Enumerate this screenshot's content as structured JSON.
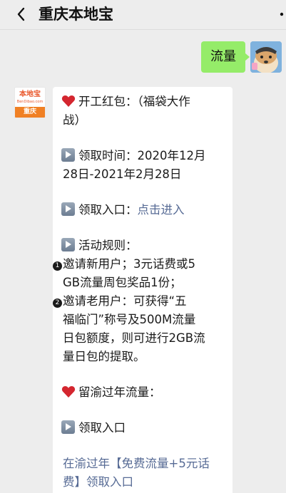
{
  "header": {
    "back_icon": "chevron-left-icon",
    "title": "重庆本地宝",
    "more_icon": "more-dots-icon"
  },
  "outgoing": {
    "text": "流量",
    "bubble_color": "#95ec69"
  },
  "brand_avatar": {
    "top_text": "本地宝",
    "site_text": "BenDibao.com",
    "city_text": "重庆",
    "accent": "#f08024"
  },
  "message": {
    "l1a": "开工红包：（福袋大作",
    "l1b": "战）",
    "time_label_a": "领取时间：2020年12月",
    "time_label_b": "28日-2021年2月28日",
    "entry_label": "领取入口：",
    "entry_link": "点击进入",
    "rules_title": "活动规则：",
    "rule1_num": "1",
    "rule1_a": "邀请新用户；3元话费或5",
    "rule1_b": "GB流量周包奖品1份；",
    "rule2_num": "2",
    "rule2_a": "邀请老用户：可获得“五",
    "rule2_b": "福临门”称号及500M流量",
    "rule2_c": "日包额度，则可进行2GB流",
    "rule2_d": "量日包的提取。",
    "section2": "留渝过年流量：",
    "entry2": "领取入口",
    "bottom_link_a": "在渝过年【免费流量+5元话",
    "bottom_link_b": "费】领取入口",
    "link_color": "#576b95"
  }
}
